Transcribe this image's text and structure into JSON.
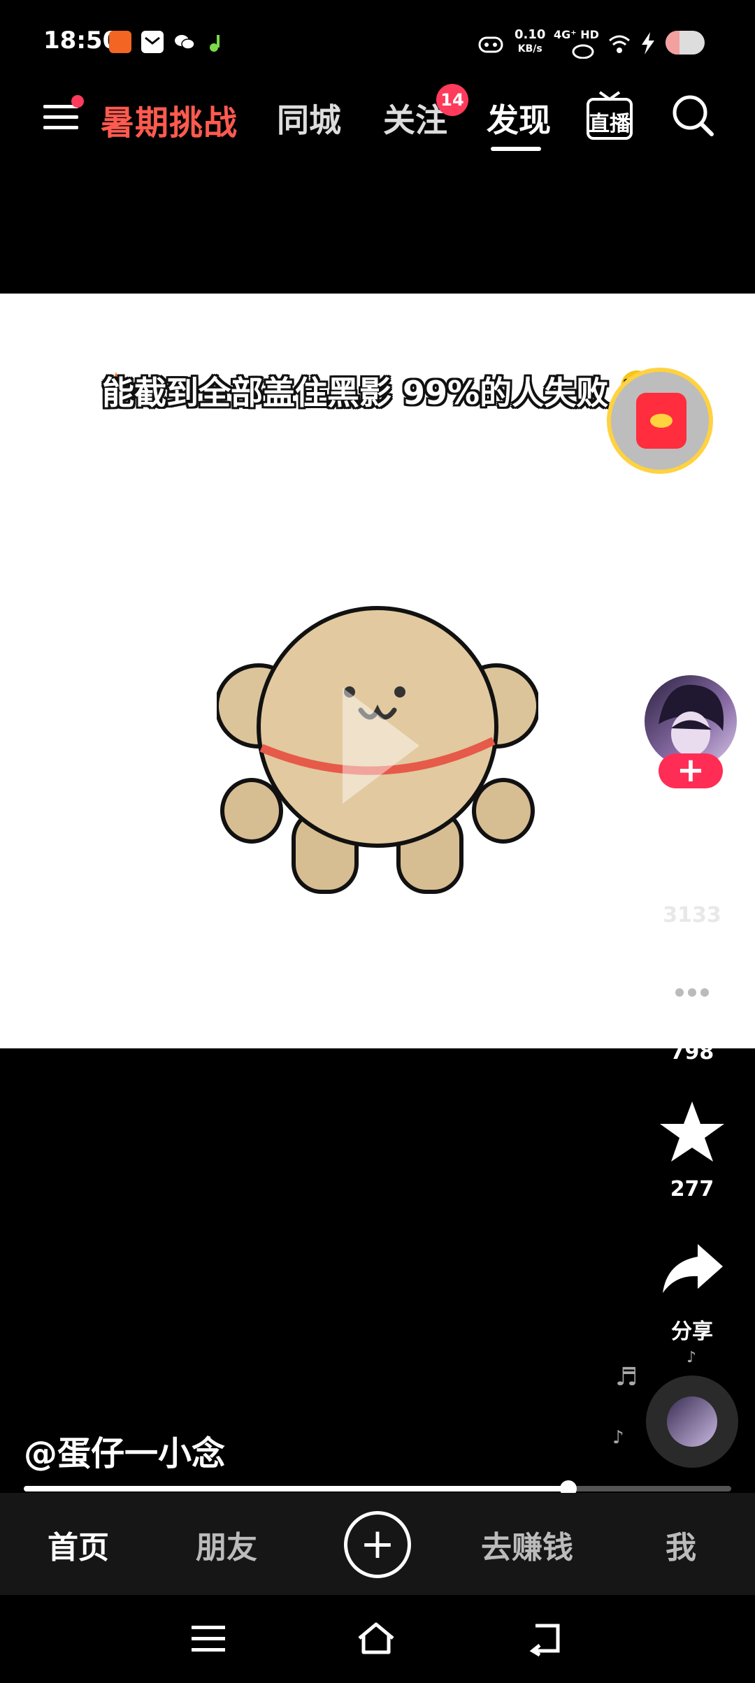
{
  "status_bar": {
    "time": "18:50",
    "net_speed_value": "0.10",
    "net_speed_unit": "KB/s",
    "net_type": "4G⁺ HD",
    "icons": [
      "app-red-icon",
      "mail-icon",
      "wechat-icon",
      "music-app-icon",
      "alarm-icon",
      "hotspot-icon",
      "wifi-icon",
      "charging-icon",
      "battery-icon"
    ]
  },
  "top_nav": {
    "promo": "暑期挑战",
    "tabs": [
      {
        "label": "同城"
      },
      {
        "label": "关注",
        "badge": "14"
      },
      {
        "label": "发现",
        "active": true
      }
    ],
    "live_label": "直播"
  },
  "video": {
    "caption": "能截到全部盖住黑影 99%的人失败",
    "progress_fraction": 0.77
  },
  "right_rail": {
    "follow_label": "+",
    "like_count": "3133",
    "comment_count": "798",
    "favorite_count": "277",
    "share_label": "分享"
  },
  "author": {
    "handle": "@蛋仔一小念"
  },
  "bottom_nav": {
    "items": [
      {
        "label": "首页",
        "active": true
      },
      {
        "label": "朋友"
      },
      {
        "label": "+"
      },
      {
        "label": "去赚钱"
      },
      {
        "label": "我"
      }
    ]
  },
  "colors": {
    "accent": "#ff2d55",
    "promo": "#ff5a4f",
    "redpacket": "#ff2d3d",
    "ring": "#ffd23f"
  }
}
